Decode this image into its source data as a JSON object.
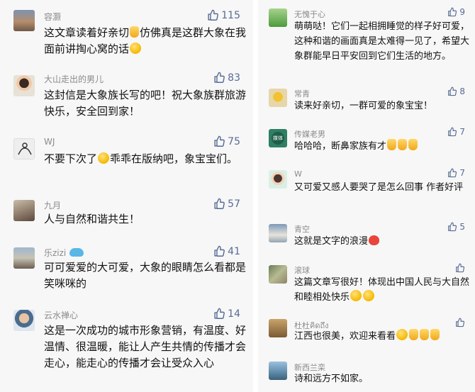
{
  "left_comments": [
    {
      "name": "容灏",
      "likes": "115",
      "text_a": "这文章读着好亲切",
      "text_b": "仿佛真是这群大象在我面前讲掏心窝的话",
      "text_c": ""
    },
    {
      "name": "大山走出的男儿",
      "likes": "83",
      "text_a": "这封信是大象族长写的吧！祝大象族群旅游快乐，安全回到家！"
    },
    {
      "name": "WJ",
      "likes": "75",
      "text_a": "不要下次了",
      "text_b": "乖乖在版纳吧，象宝宝们。"
    },
    {
      "name": "九月",
      "likes": "57",
      "text_a": "人与自然和谐共生！"
    },
    {
      "name": "乐zizi",
      "likes": "41",
      "text_a": "可可爱爱的大可爱，大象的眼睛怎么看都是笑咪咪的"
    },
    {
      "name": "云水禅心",
      "likes": "14",
      "text_a": "这是一次成功的城市形象营销，有温度、好温情、很温暖，能让人产生共情的传播才会走心，能走心的传播才会让受众入心"
    }
  ],
  "right_comments": [
    {
      "name": "无愧于心",
      "likes": "9",
      "text_a": "萌萌哒！它们一起相拥睡觉的样子好可爱，这种和谐的画面真是太难得一见了，希望大象群能早日平安回到它们生活的地方。"
    },
    {
      "name": "常青",
      "likes": "8",
      "text_a": "读来好亲切，一群可爱的象宝宝！"
    },
    {
      "name": "传媒老男",
      "likes": "7",
      "text_a": "哈哈哈，断鼻家族有才"
    },
    {
      "name": "W",
      "likes": "7",
      "text_a": "又可爱又感人要哭了是怎么回事 作者好评"
    },
    {
      "name": "青空",
      "likes": "5",
      "text_a": "这就是文字的浪漫"
    },
    {
      "name": "滚球",
      "likes": "",
      "text_a": "这篇文章写很好！体现出中国人民与大自然和睦相处快乐"
    },
    {
      "name": "杜杜คิดถึง",
      "likes": "",
      "text_a": "江西也很美，欢迎来看看"
    },
    {
      "name": "新西兰栾",
      "likes": "",
      "text_a": "诗和远方不如家。"
    }
  ],
  "avatar_texts": {
    "media": "媒体"
  },
  "colors": {
    "like": "#576b95",
    "name": "#8a8a8a",
    "text": "#111111",
    "panel": "#f7f7f7"
  },
  "icons": {
    "like": "thumbs-up-outline-icon"
  }
}
